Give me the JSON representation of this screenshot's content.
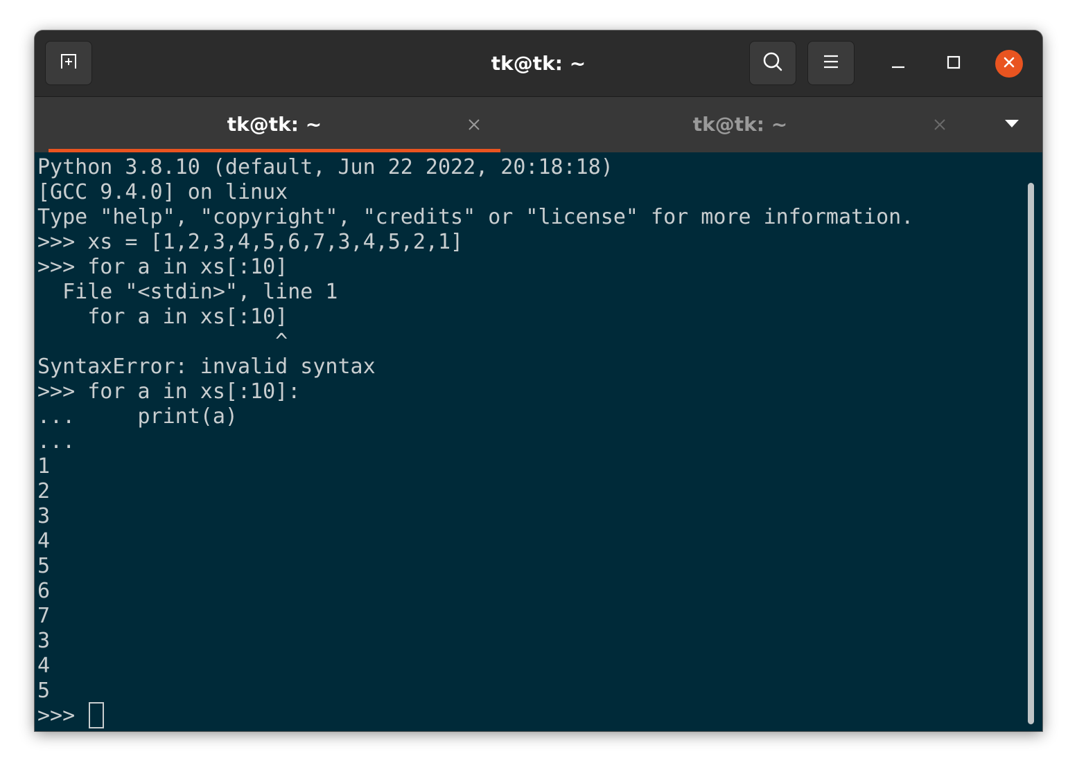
{
  "window": {
    "title": "tk@tk: ~"
  },
  "headerbar": {
    "new_tab_icon": "new-tab-icon",
    "search_icon": "search-icon",
    "menu_icon": "hamburger-menu-icon",
    "minimize_icon": "minimize-icon",
    "maximize_icon": "maximize-icon",
    "close_icon": "close-icon"
  },
  "tabs": [
    {
      "label": "tk@tk: ~",
      "active": true
    },
    {
      "label": "tk@tk: ~",
      "active": false
    }
  ],
  "terminal": {
    "lines": [
      "Python 3.8.10 (default, Jun 22 2022, 20:18:18)",
      "[GCC 9.4.0] on linux",
      "Type \"help\", \"copyright\", \"credits\" or \"license\" for more information.",
      ">>> xs = [1,2,3,4,5,6,7,3,4,5,2,1]",
      ">>> for a in xs[:10]",
      "  File \"<stdin>\", line 1",
      "    for a in xs[:10]",
      "                   ^",
      "SyntaxError: invalid syntax",
      ">>> for a in xs[:10]:",
      "...     print(a)",
      "...",
      "1",
      "2",
      "3",
      "4",
      "5",
      "6",
      "7",
      "3",
      "4",
      "5"
    ],
    "prompt": ">>> "
  },
  "colors": {
    "accent": "#e95420",
    "terminal_bg": "#002a39",
    "terminal_fg": "#c9ced0",
    "headerbar_bg": "#2c2c2c",
    "tabbar_bg": "#383838"
  }
}
